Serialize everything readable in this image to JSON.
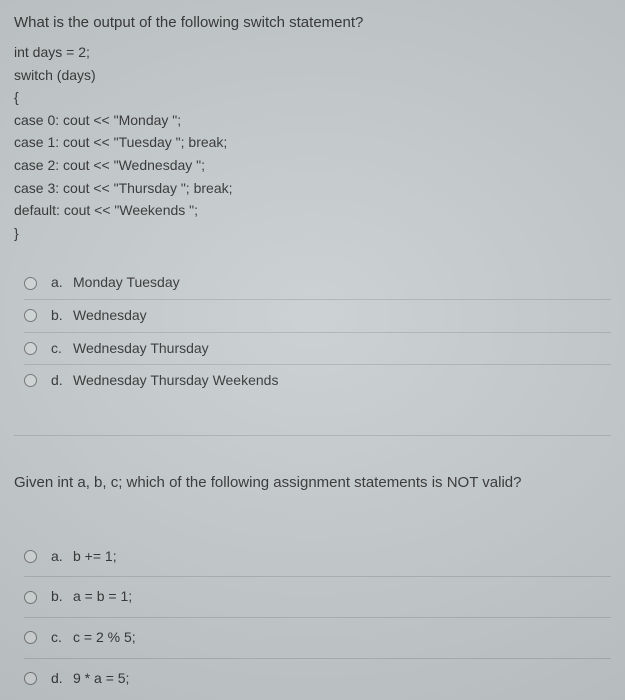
{
  "q1": {
    "title": "What is the output of the following switch statement?",
    "code": [
      "int days = 2;",
      "switch (days)",
      "{",
      "case 0: cout << \"Monday \";",
      "case 1: cout << \"Tuesday \"; break;",
      "case 2: cout << \"Wednesday \";",
      "case 3: cout << \"Thursday \"; break;",
      "default: cout << \"Weekends \";",
      "}"
    ],
    "answers": [
      {
        "letter": "a.",
        "text": "Monday Tuesday"
      },
      {
        "letter": "b.",
        "text": "Wednesday"
      },
      {
        "letter": "c.",
        "text": "Wednesday Thursday"
      },
      {
        "letter": "d.",
        "text": "Wednesday Thursday Weekends"
      }
    ]
  },
  "q2": {
    "title": "Given int a, b, c;   which of the following assignment statements is NOT valid?",
    "answers": [
      {
        "letter": "a.",
        "text": "b += 1;"
      },
      {
        "letter": "b.",
        "text": "a = b = 1;"
      },
      {
        "letter": "c.",
        "text": "c = 2 % 5;"
      },
      {
        "letter": "d.",
        "text": "9 * a = 5;"
      }
    ]
  }
}
